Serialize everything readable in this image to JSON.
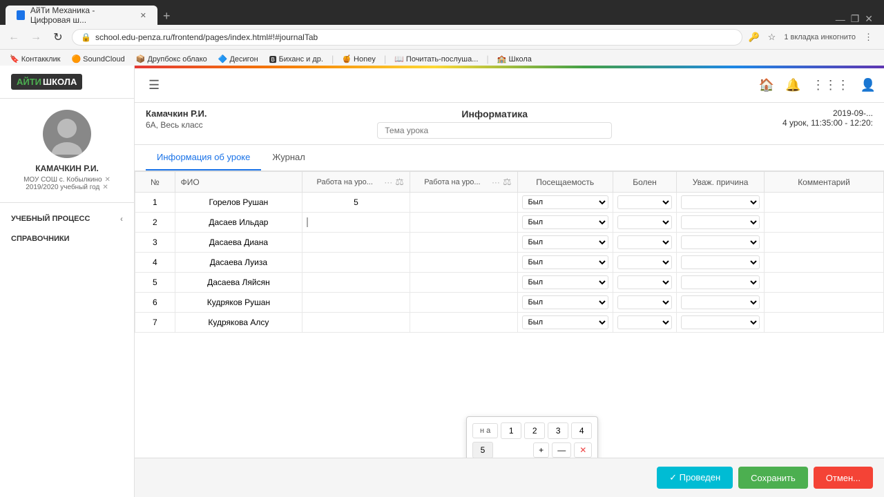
{
  "browser": {
    "tab_title": "АйТи Механика - Цифровая ш...",
    "tab_new": "+",
    "url": "school.edu-penza.ru/frontend/pages/index.html#!#journalTab",
    "incognito": "1 вкладка инкогнито",
    "bookmarks": [
      {
        "label": "Контакклик",
        "icon": "🔖"
      },
      {
        "label": "SoundCloud",
        "icon": "🟠"
      },
      {
        "label": "Друпбокс облако",
        "icon": "📦"
      },
      {
        "label": "Десигон",
        "icon": "🔷"
      },
      {
        "label": "Биханс и др.",
        "icon": "🅱"
      },
      {
        "label": "Honey",
        "icon": "🍯"
      },
      {
        "label": "Почитать-послуша...",
        "icon": "📖"
      },
      {
        "label": "Школа",
        "icon": "🏫"
      }
    ],
    "win_minimize": "—",
    "win_maximize": "❐",
    "win_close": "✕"
  },
  "logo": {
    "aiti": "АЙТИ",
    "school": "ШКОЛА"
  },
  "user": {
    "name": "КАМАЧКИН Р.И.",
    "school": "МОУ СОШ с. Кобылкино",
    "year": "2019/2020 учебный год"
  },
  "sidebar_sections": [
    {
      "label": "УЧЕБНЫЙ ПРОЦЕСС"
    },
    {
      "label": "СПРАВОЧНИКИ"
    }
  ],
  "lesson": {
    "teacher": "Камачкин Р.И.",
    "class": "6А, Весь класс",
    "subject": "Информатика",
    "topic_placeholder": "Тема урока",
    "date": "2019-09-...",
    "lesson_num": "4 урок, 11:35:00 - 12:20:"
  },
  "tabs": [
    {
      "label": "Информация об уроке",
      "active": true
    },
    {
      "label": "Журнал",
      "active": false
    }
  ],
  "table": {
    "headers": {
      "num": "№",
      "name": "ФИО",
      "work1": "Работа на уро...",
      "work2": "Работа на уро...",
      "attend": "Посещаемость",
      "sick": "Болен",
      "reason": "Уваж. причина",
      "comment": "Комментарий"
    },
    "rows": [
      {
        "num": 1,
        "name": "Горелов Рушан",
        "grade1": "5",
        "grade2": "",
        "attend": "Был",
        "sick": "",
        "reason": "",
        "comment": ""
      },
      {
        "num": 2,
        "name": "Дасаев Ильдар",
        "grade1": "",
        "grade2": "",
        "attend": "Был",
        "sick": "",
        "reason": "",
        "comment": ""
      },
      {
        "num": 3,
        "name": "Дасаева Диана",
        "grade1": "",
        "grade2": "",
        "attend": "Был",
        "sick": "",
        "reason": "",
        "comment": ""
      },
      {
        "num": 4,
        "name": "Дасаева Луиза",
        "grade1": "",
        "grade2": "",
        "attend": "Был",
        "sick": "",
        "reason": "",
        "comment": ""
      },
      {
        "num": 5,
        "name": "Дасаева Ляйсян",
        "grade1": "",
        "grade2": "",
        "attend": "Был",
        "sick": "",
        "reason": "",
        "comment": ""
      },
      {
        "num": 6,
        "name": "Кудряков Рушан",
        "grade1": "",
        "grade2": "",
        "attend": "Был",
        "sick": "",
        "reason": "",
        "comment": ""
      },
      {
        "num": 7,
        "name": "Кудрякова Алсу",
        "grade1": "",
        "grade2": "",
        "attend": "Был",
        "sick": "",
        "reason": "",
        "comment": ""
      }
    ],
    "grade_popup": {
      "na": "н а",
      "grades": [
        "1",
        "2",
        "3",
        "4"
      ],
      "grade5": "5",
      "btn_plus": "+",
      "btn_minus": "—",
      "btn_clear": "✕"
    }
  },
  "footer": {
    "conducted_label": "✓ Проведен",
    "save_label": "Сохранить",
    "cancel_label": "Отмен..."
  }
}
